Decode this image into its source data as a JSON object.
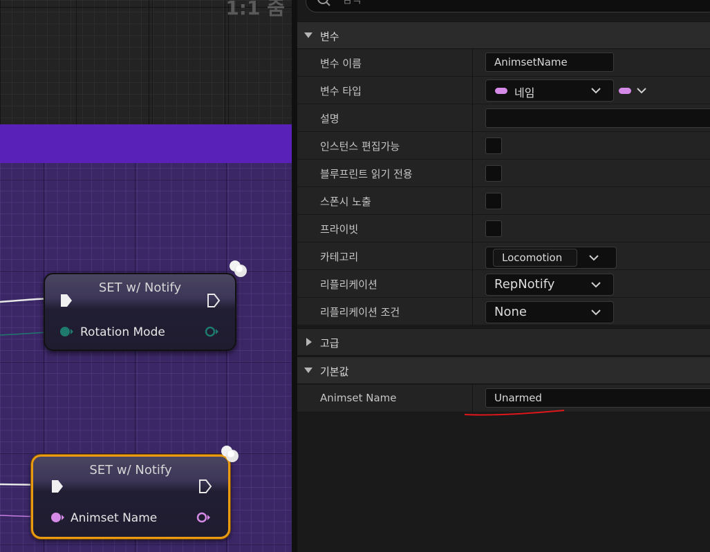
{
  "graph": {
    "zoom_label": "1:1 줌",
    "node_rotation": {
      "title": "SET w/ Notify",
      "pin_label": "Rotation Mode",
      "pin_color": "#1f7a6e"
    },
    "node_animset": {
      "title": "SET w/ Notify",
      "pin_label": "Animset Name",
      "pin_color": "#d68ae8",
      "selected_border": "#e89b12"
    },
    "comment_color": "#5a21b8"
  },
  "details": {
    "search": {
      "placeholder": "검색"
    },
    "sections": {
      "variable": "변수",
      "advanced": "고급",
      "default": "기본값"
    },
    "rows": {
      "var_name": {
        "label": "변수 이름",
        "value": "AnimsetName"
      },
      "var_type": {
        "label": "변수 타입",
        "value": "네임",
        "type_color": "#d68ae8"
      },
      "description": {
        "label": "설명",
        "value": ""
      },
      "instance_editable": {
        "label": "인스턴스 편집가능",
        "checked": false
      },
      "bp_readonly": {
        "label": "블루프린트 읽기 전용",
        "checked": false
      },
      "expose_spawn": {
        "label": "스폰시 노출",
        "checked": false
      },
      "private": {
        "label": "프라이빗",
        "checked": false
      },
      "category": {
        "label": "카테고리",
        "value": "Locomotion"
      },
      "replication": {
        "label": "리플리케이션",
        "value": "RepNotify"
      },
      "rep_condition": {
        "label": "리플리케이션 조건",
        "value": "None"
      },
      "animset_default": {
        "label": "Animset Name",
        "value": "Unarmed"
      }
    },
    "annotation_color": "#e0161b"
  }
}
